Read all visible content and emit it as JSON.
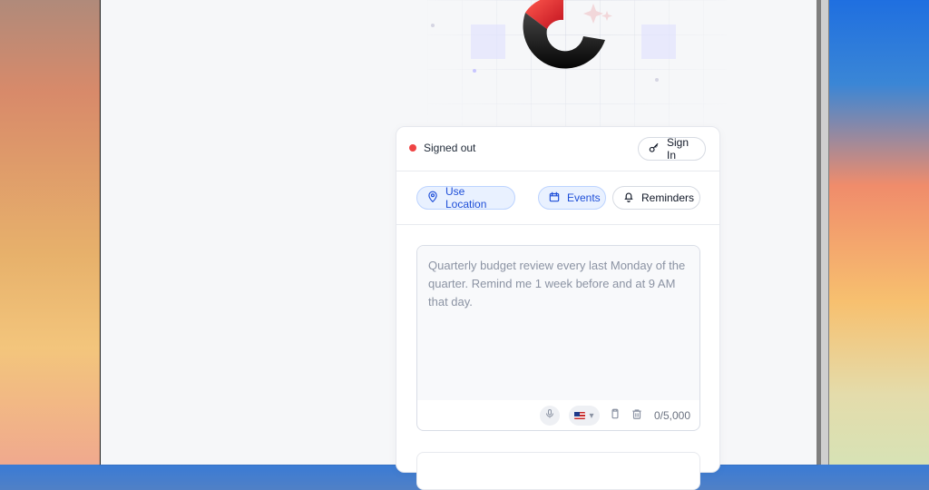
{
  "header": {
    "status_text": "Signed out",
    "signin_label": "Sign In"
  },
  "filters": {
    "use_location_label": "Use Location",
    "events_label": "Events",
    "reminders_label": "Reminders"
  },
  "editor": {
    "placeholder": "Quarterly budget review every last Monday of the quarter. Remind me 1 week before and at 9 AM that day.",
    "language_flag": "us-flag",
    "char_count": "0/5,000"
  },
  "icons": {
    "status": "status-dot",
    "signin": "key-icon",
    "location": "map-pin-icon",
    "events": "calendar-icon",
    "reminders": "bell-icon",
    "mic": "mic-icon",
    "paste": "clipboard-icon",
    "delete": "trash-icon",
    "logo": "app-logo"
  },
  "colors": {
    "accent_blue": "#1d4ed8",
    "status_red": "#ef4444"
  }
}
